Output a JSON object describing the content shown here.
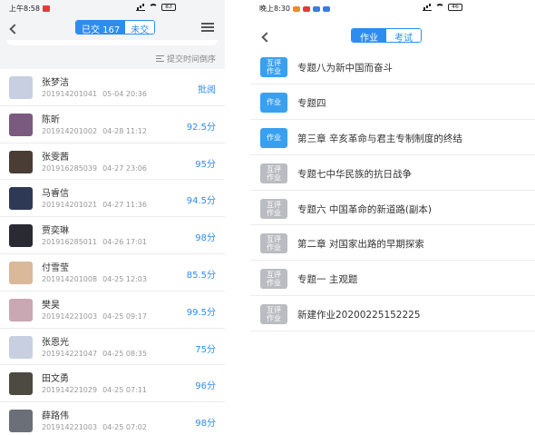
{
  "left": {
    "status_time": "上午8:58",
    "status_battery": "83",
    "tab_submitted": "已交 167",
    "tab_unsubmitted": "未交",
    "sort_label": "提交时间倒序",
    "students": [
      {
        "name": "张梦洁",
        "id": "201914201041",
        "time": "05-04 20:36",
        "score": "批阅",
        "avatar": "#c7cfe0"
      },
      {
        "name": "陈昕",
        "id": "201914201002",
        "time": "04-28 11:12",
        "score": "92.5分",
        "avatar": "#7a5a7e"
      },
      {
        "name": "张雯茜",
        "id": "201916285039",
        "time": "04-27 23:06",
        "score": "95分",
        "avatar": "#4a3d35"
      },
      {
        "name": "马睿信",
        "id": "201914201021",
        "time": "04-27 11:36",
        "score": "94.5分",
        "avatar": "#2e3a55"
      },
      {
        "name": "贾奕琳",
        "id": "201916285011",
        "time": "04-26 17:01",
        "score": "98分",
        "avatar": "#2a2a33"
      },
      {
        "name": "付雪莹",
        "id": "201914201008",
        "time": "04-25 12:03",
        "score": "85.5分",
        "avatar": "#d9b99a"
      },
      {
        "name": "樊昊",
        "id": "201914221003",
        "time": "04-25 09:17",
        "score": "99.5分",
        "avatar": "#c9a7b3"
      },
      {
        "name": "张恩光",
        "id": "201914221047",
        "time": "04-25 08:35",
        "score": "75分",
        "avatar": "#c7cfe0"
      },
      {
        "name": "田文勇",
        "id": "201914221029",
        "time": "04-25 07:11",
        "score": "96分",
        "avatar": "#4d4a42"
      },
      {
        "name": "薛路伟",
        "id": "201914221003",
        "time": "04-25 07:02",
        "score": "98分",
        "avatar": "#6b6f78"
      }
    ]
  },
  "right": {
    "status_time": "晚上8:30",
    "status_battery": "46",
    "tab_homework": "作业",
    "tab_exam": "考试",
    "homeworks": [
      {
        "tag": "互评\n作业",
        "tag_color": "blue",
        "title": "专题八为新中国而奋斗"
      },
      {
        "tag": "作业",
        "tag_color": "blue",
        "title": "专题四"
      },
      {
        "tag": "作业",
        "tag_color": "blue",
        "title": "第三章 辛亥革命与君主专制制度的终结"
      },
      {
        "tag": "互评\n作业",
        "tag_color": "gray",
        "title": "专题七中华民族的抗日战争"
      },
      {
        "tag": "互评\n作业",
        "tag_color": "gray",
        "title": "专题六 中国革命的新道路(副本)"
      },
      {
        "tag": "互评\n作业",
        "tag_color": "gray",
        "title": "第二章 对国家出路的早期探索"
      },
      {
        "tag": "互评\n作业",
        "tag_color": "gray",
        "title": "专题一 主观题"
      },
      {
        "tag": "互评\n作业",
        "tag_color": "gray",
        "title": "新建作业20200225152225"
      }
    ]
  },
  "colors": {
    "accent": "#2d8cf0",
    "tag_blue": "#39a0f0",
    "tag_gray": "#b9bcc0"
  }
}
